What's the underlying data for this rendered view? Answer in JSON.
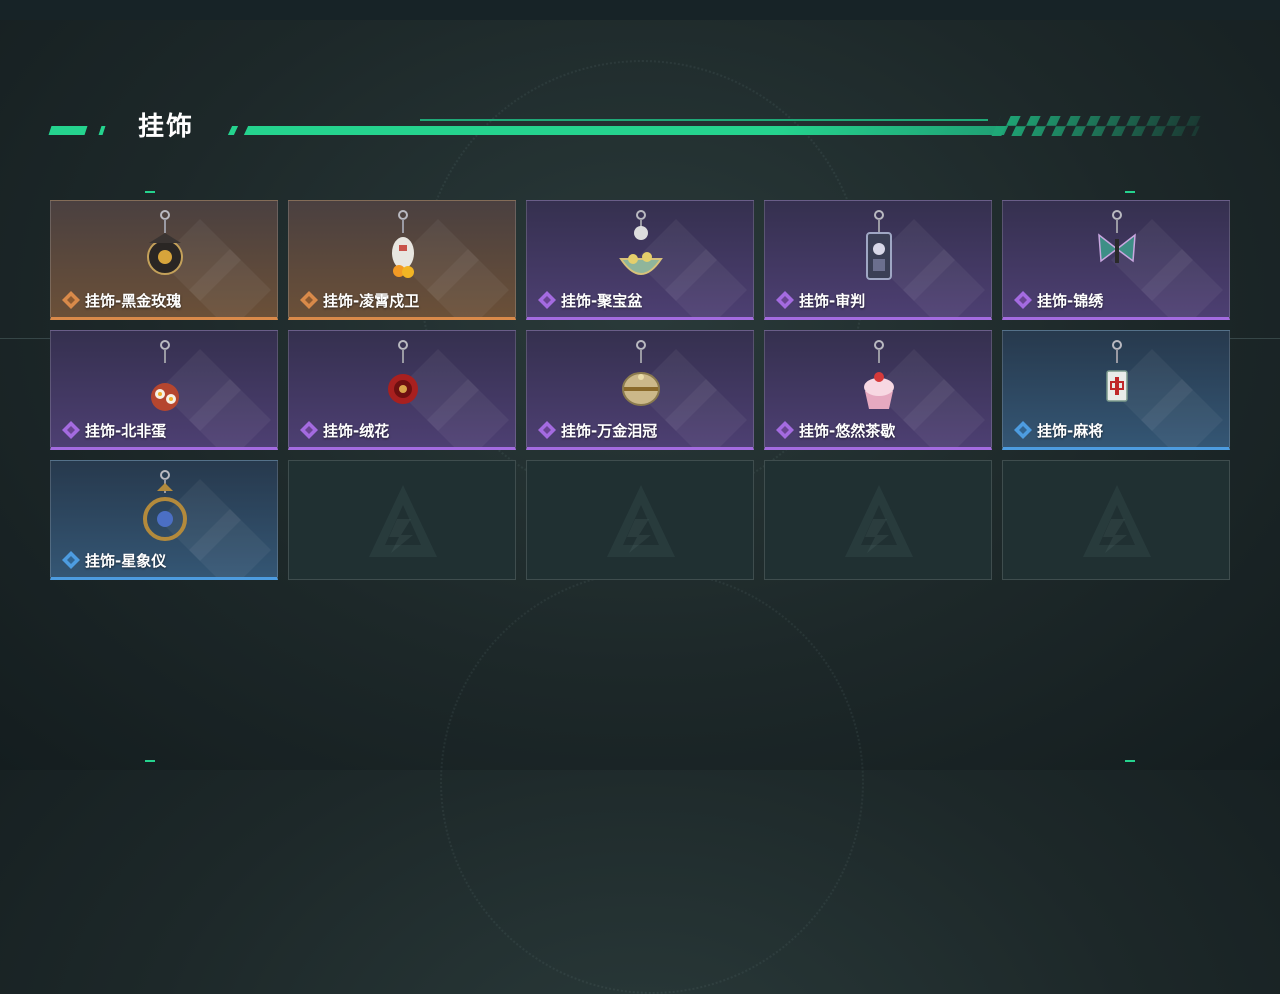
{
  "section": {
    "title": "挂饰"
  },
  "colors": {
    "accent": "#25d38e",
    "orange": "#d98a4a",
    "purple": "#a46be0",
    "blue": "#4d9ce0"
  },
  "items": [
    {
      "label": "挂饰-黑金玫瑰",
      "rarity": "orange",
      "icon": "black-gold-rose-charm-icon"
    },
    {
      "label": "挂饰-凌霄戍卫",
      "rarity": "orange",
      "icon": "sky-guard-charm-icon"
    },
    {
      "label": "挂饰-聚宝盆",
      "rarity": "purple",
      "icon": "treasure-bowl-charm-icon"
    },
    {
      "label": "挂饰-审判",
      "rarity": "purple",
      "icon": "judgment-card-charm-icon"
    },
    {
      "label": "挂饰-锦绣",
      "rarity": "purple",
      "icon": "butterfly-charm-icon"
    },
    {
      "label": "挂饰-北非蛋",
      "rarity": "purple",
      "icon": "shakshuka-charm-icon"
    },
    {
      "label": "挂饰-绒花",
      "rarity": "purple",
      "icon": "velvet-flower-charm-icon"
    },
    {
      "label": "挂饰-万金泪冠",
      "rarity": "purple",
      "icon": "golden-crown-charm-icon"
    },
    {
      "label": "挂饰-悠然茶歇",
      "rarity": "purple",
      "icon": "cupcake-charm-icon"
    },
    {
      "label": "挂饰-麻将",
      "rarity": "blue",
      "icon": "mahjong-tile-charm-icon"
    },
    {
      "label": "挂饰-星象仪",
      "rarity": "blue",
      "icon": "astrolabe-charm-icon"
    },
    {
      "label": "",
      "rarity": "empty",
      "icon": "empty-slot-logo-icon"
    },
    {
      "label": "",
      "rarity": "empty",
      "icon": "empty-slot-logo-icon"
    },
    {
      "label": "",
      "rarity": "empty",
      "icon": "empty-slot-logo-icon"
    },
    {
      "label": "",
      "rarity": "empty",
      "icon": "empty-slot-logo-icon"
    }
  ]
}
